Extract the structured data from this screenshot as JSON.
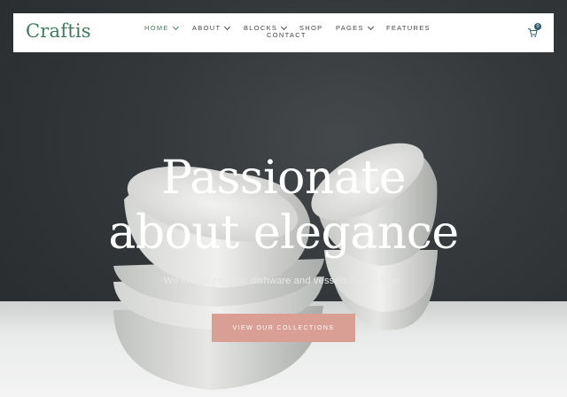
{
  "brand": {
    "logo_text": "Craftis",
    "accent_color": "#3d7a5a"
  },
  "nav": {
    "items": [
      {
        "label": "HOME",
        "dropdown": true,
        "active": true
      },
      {
        "label": "ABOUT",
        "dropdown": true,
        "active": false
      },
      {
        "label": "BLOCKS",
        "dropdown": true,
        "active": false
      },
      {
        "label": "SHOP",
        "dropdown": false,
        "active": false
      },
      {
        "label": "PAGES",
        "dropdown": true,
        "active": false
      },
      {
        "label": "FEATURES",
        "dropdown": false,
        "active": false
      },
      {
        "label": "CONTACT",
        "dropdown": false,
        "active": false
      }
    ],
    "cart": {
      "icon": "cart-icon",
      "count": "0"
    }
  },
  "hero": {
    "headline_line1": "Passionate",
    "headline_line2": "about elegance",
    "subtitle": "We create ceramic dishware and vessels rich in form.",
    "cta_label": "VIEW OUR COLLECTIONS",
    "cta_color": "#d99e94"
  }
}
